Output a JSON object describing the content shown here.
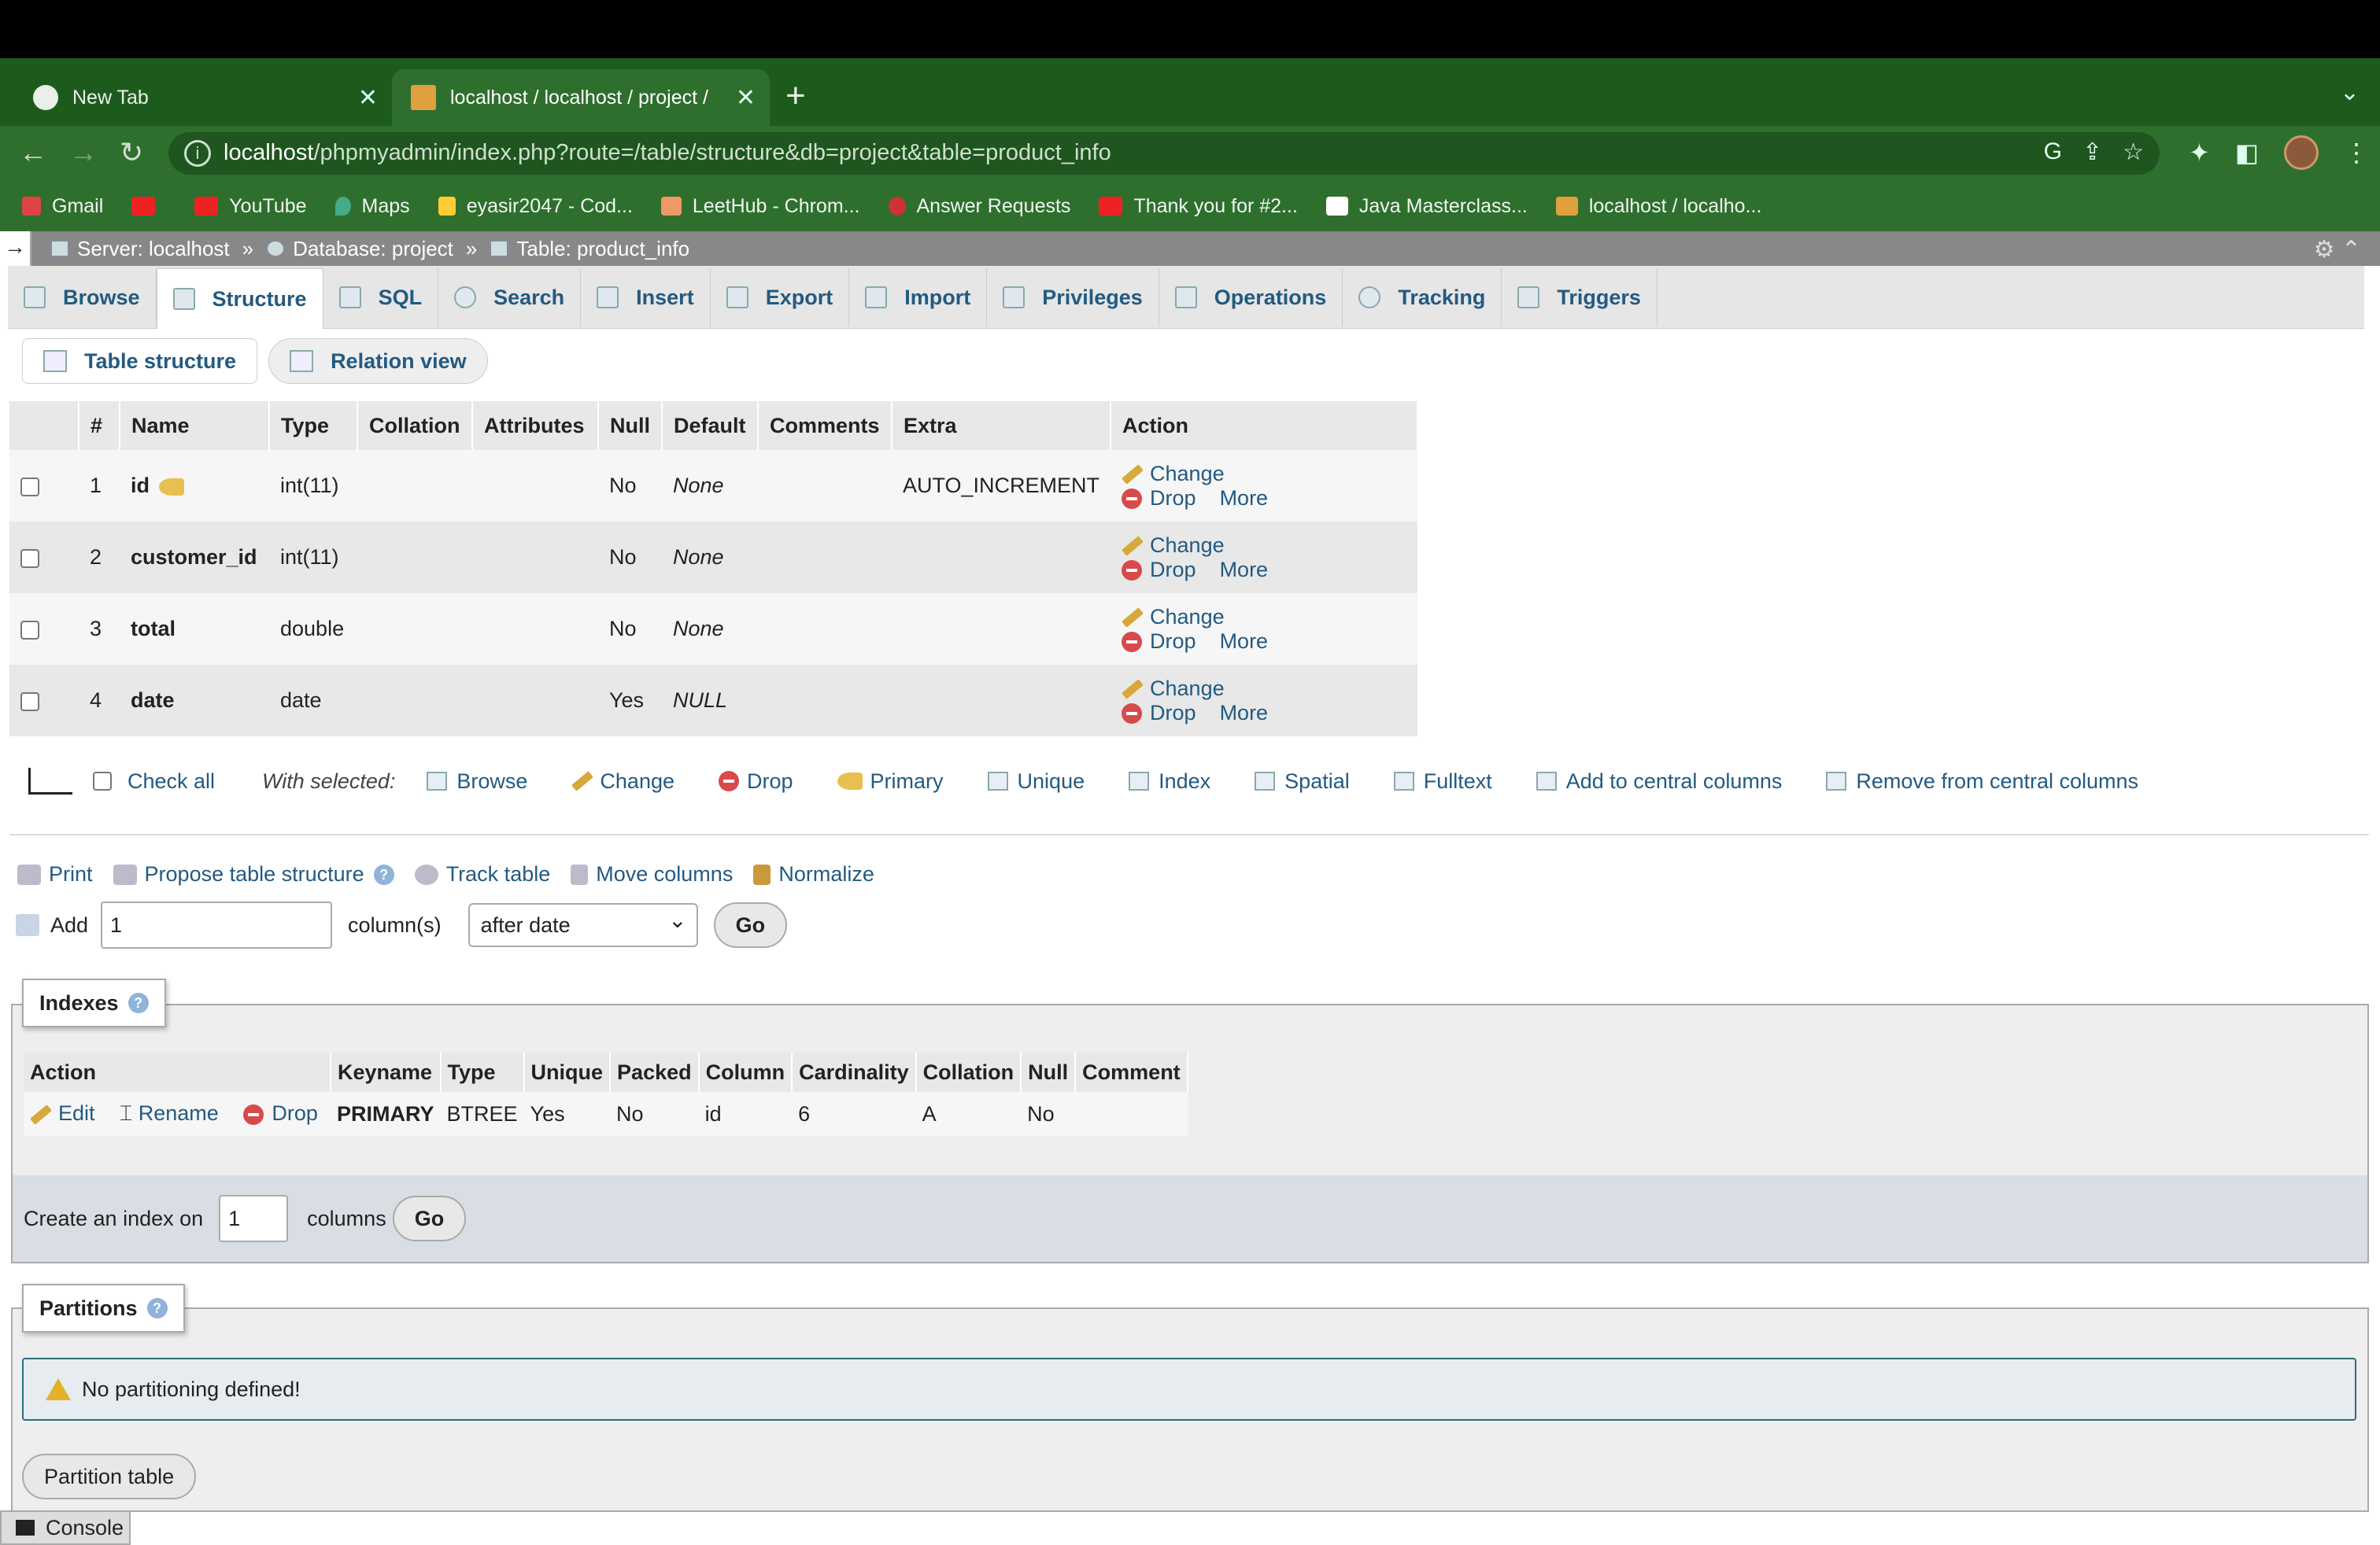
{
  "browser": {
    "tabs": [
      {
        "title": "New Tab",
        "active": false
      },
      {
        "title": "localhost / localhost / project /",
        "active": true
      }
    ],
    "new_tab": "+",
    "url_host": "localhost",
    "url_path": "/phpmyadmin/index.php?route=/table/structure&db=project&table=product_info",
    "bookmarks": [
      "Gmail",
      "YouTube",
      "Maps",
      "eyasir2047 - Cod...",
      "LeetHub - Chrom...",
      "Answer Requests",
      "Thank you for #2...",
      "Java Masterclass...",
      "localhost / localho..."
    ]
  },
  "breadcrumb": {
    "arrow": "→",
    "server": "Server: localhost",
    "database": "Database: project",
    "table": "Table: product_info",
    "sep": "»"
  },
  "tabs": [
    "Browse",
    "Structure",
    "SQL",
    "Search",
    "Insert",
    "Export",
    "Import",
    "Privileges",
    "Operations",
    "Tracking",
    "Triggers"
  ],
  "subtabs": {
    "table_structure": "Table structure",
    "relation_view": "Relation view"
  },
  "structure": {
    "headers": [
      "#",
      "Name",
      "Type",
      "Collation",
      "Attributes",
      "Null",
      "Default",
      "Comments",
      "Extra",
      "Action"
    ],
    "rows": [
      {
        "num": "1",
        "name": "id",
        "type": "int(11)",
        "null": "No",
        "default": "None",
        "extra": "AUTO_INCREMENT"
      },
      {
        "num": "2",
        "name": "customer_id",
        "type": "int(11)",
        "null": "No",
        "default": "None",
        "extra": ""
      },
      {
        "num": "3",
        "name": "total",
        "type": "double",
        "null": "No",
        "default": "None",
        "extra": ""
      },
      {
        "num": "4",
        "name": "date",
        "type": "date",
        "null": "Yes",
        "default": "NULL",
        "extra": ""
      }
    ],
    "actions": {
      "change": "Change",
      "drop": "Drop",
      "more": "More"
    }
  },
  "with_selected": {
    "check_all": "Check all",
    "label": "With selected:",
    "actions": [
      "Browse",
      "Change",
      "Drop",
      "Primary",
      "Unique",
      "Index",
      "Spatial",
      "Fulltext",
      "Add to central columns",
      "Remove from central columns"
    ]
  },
  "tools": {
    "print": "Print",
    "propose": "Propose table structure",
    "track": "Track table",
    "move": "Move columns",
    "normalize": "Normalize"
  },
  "add_columns": {
    "label": "Add",
    "count": "1",
    "unit": "column(s)",
    "position": "after date",
    "go": "Go"
  },
  "indexes": {
    "legend": "Indexes",
    "headers": [
      "Action",
      "Keyname",
      "Type",
      "Unique",
      "Packed",
      "Column",
      "Cardinality",
      "Collation",
      "Null",
      "Comment"
    ],
    "row": {
      "edit": "Edit",
      "rename": "Rename",
      "drop": "Drop",
      "keyname": "PRIMARY",
      "type": "BTREE",
      "unique": "Yes",
      "packed": "No",
      "column": "id",
      "cardinality": "6",
      "collation": "A",
      "null": "No",
      "comment": ""
    },
    "create_label": "Create an index on",
    "create_count": "1",
    "create_unit": "columns",
    "go": "Go"
  },
  "partitions": {
    "legend": "Partitions",
    "message": "No partitioning defined!",
    "button": "Partition table"
  },
  "console": "Console"
}
